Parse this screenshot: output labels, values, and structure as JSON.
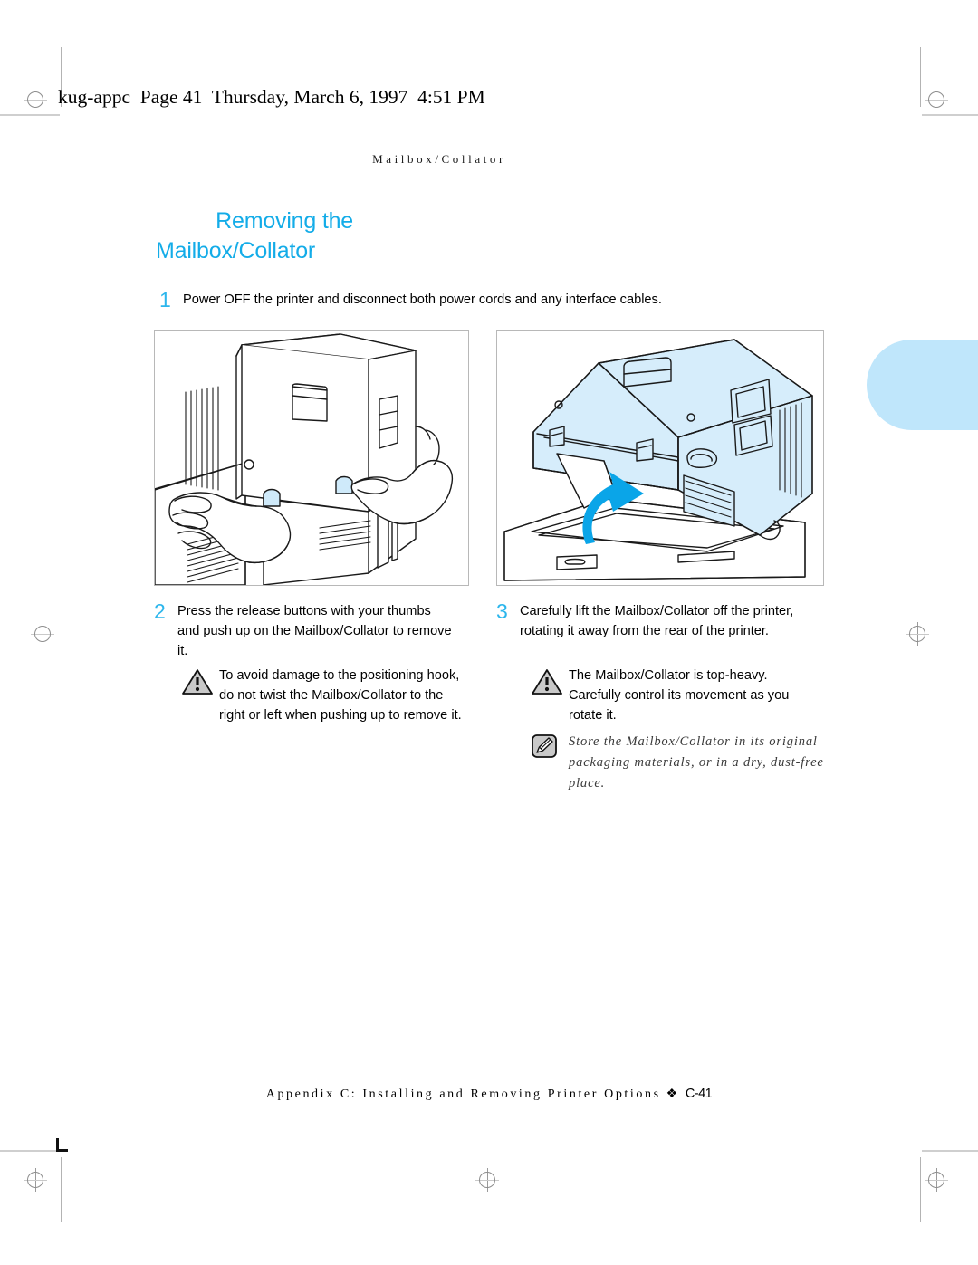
{
  "header": {
    "file_line": "kug-appc  Page 41  Thursday, March 6, 1997  4:51 PM"
  },
  "running_head": "Mailbox/Collator",
  "title": {
    "line1": "Removing the",
    "line2": "Mailbox/Collator",
    "accent_color": "#13ace8"
  },
  "thumb_tab": {
    "color": "#bfe6fb"
  },
  "steps": [
    {
      "number": "1",
      "text": "Power OFF the printer and disconnect both power cords and any interface cables."
    },
    {
      "number": "2",
      "text": "Press the release buttons with your thumbs and push up on the Mailbox/Collator to remove it."
    },
    {
      "number": "3",
      "text": "Carefully lift the Mailbox/Collator off the printer, rotating it away from the rear of the printer."
    }
  ],
  "notes": [
    {
      "icon": "warning-triangle-icon",
      "text": "To avoid damage to the positioning hook, do not twist the Mailbox/Collator to the right or left when pushing up to remove it."
    },
    {
      "icon": "warning-triangle-icon",
      "text": "The Mailbox/Collator is top-heavy. Carefully control its movement as you rotate it."
    },
    {
      "icon": "pencil-note-icon",
      "text": "Store the Mailbox/Collator in its original packaging materials, or in a dry, dust-free place."
    }
  ],
  "figures": [
    {
      "caption_ref": "2",
      "description": "Line drawing: two hands pressing the release buttons and pushing up on the Mailbox/Collator mounted on the printer"
    },
    {
      "caption_ref": "3",
      "description": "Line drawing: Mailbox/Collator tilted up off the printer with a curved arrow indicating rotation away from the rear",
      "arrow_color": "#0aa5e8",
      "unit_fill": "#d6edfb"
    }
  ],
  "footer": {
    "text": "Appendix C: Installing and Removing Printer Options",
    "separator": "❖",
    "page": "C-41"
  }
}
